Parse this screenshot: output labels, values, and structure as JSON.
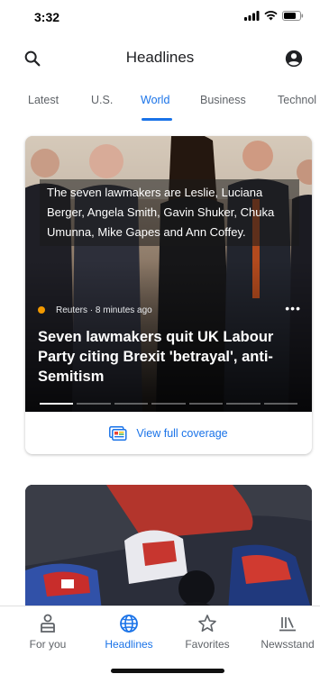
{
  "status": {
    "time": "3:32",
    "icons": [
      "signal-icon",
      "wifi-icon",
      "battery-icon"
    ]
  },
  "header": {
    "title": "Headlines",
    "search_icon": "search-icon",
    "account_icon": "account-icon"
  },
  "tabs": [
    {
      "label": "Latest",
      "active": false
    },
    {
      "label": "U.S.",
      "active": false
    },
    {
      "label": "World",
      "active": true
    },
    {
      "label": "Business",
      "active": false
    },
    {
      "label": "Technol",
      "active": false
    }
  ],
  "story": {
    "caption": "The seven lawmakers are Leslie, Luciana Berger, Angela Smith, Gavin Shuker, Chuka Umunna, Mike Gapes and Ann Coffey.",
    "source": "Reuters · 8 minutes ago",
    "more": "•••",
    "headline": "Seven lawmakers quit UK Labour Party citing Brexit 'betrayal', anti-Semitism",
    "slides_total": 7,
    "slide_current": 1,
    "coverage_label": "View full coverage"
  },
  "bottom_nav": [
    {
      "label": "For you",
      "icon": "person-icon",
      "active": false
    },
    {
      "label": "Headlines",
      "icon": "globe-icon",
      "active": true
    },
    {
      "label": "Favorites",
      "icon": "star-icon",
      "active": false
    },
    {
      "label": "Newsstand",
      "icon": "newsstand-icon",
      "active": false
    }
  ],
  "colors": {
    "accent": "#1a73e8",
    "text": "#202124",
    "muted": "#5f6368",
    "source_dot": "#f29900"
  }
}
